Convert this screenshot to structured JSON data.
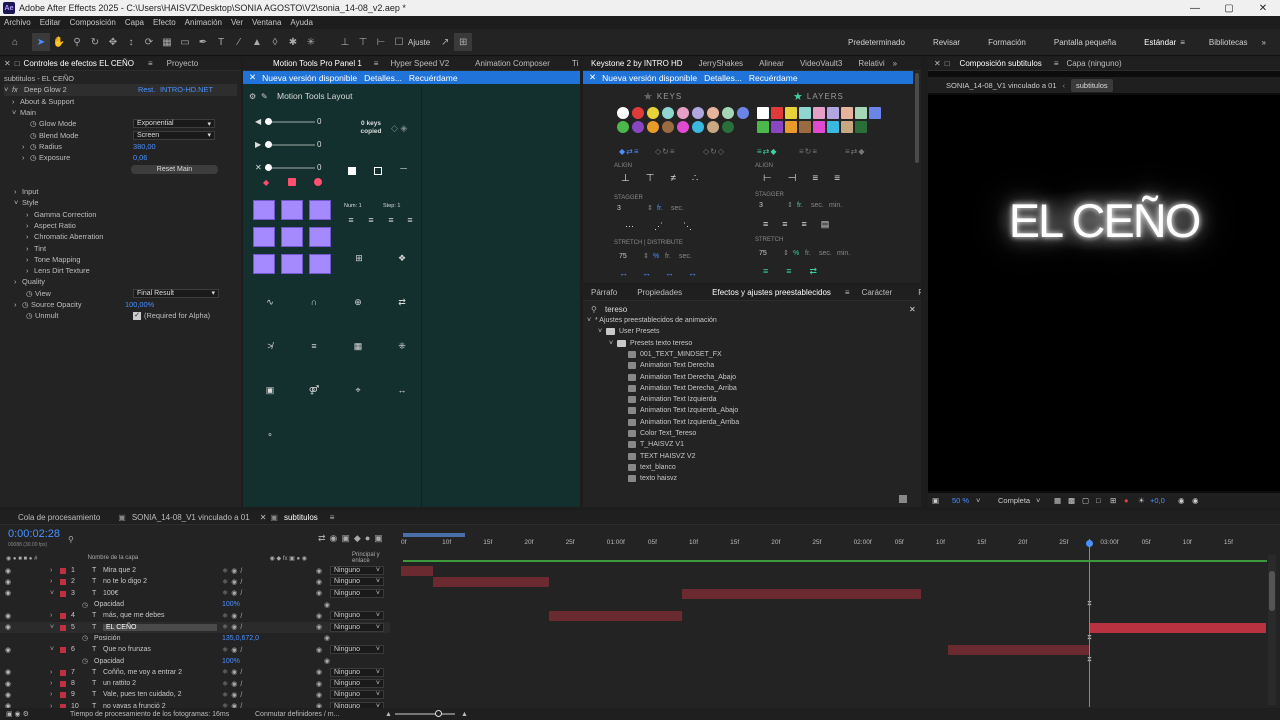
{
  "titlebar": {
    "app_title": "Adobe After Effects 2025 - C:\\Users\\HAISVZ\\Desktop\\SONIA AGOSTO\\V2\\sonia_14-08_v2.aep *",
    "logo": "Ae"
  },
  "menu": [
    "Archivo",
    "Editar",
    "Composición",
    "Capa",
    "Efecto",
    "Animación",
    "Ver",
    "Ventana",
    "Ayuda"
  ],
  "toolbar": {
    "snap_label": "Ajuste"
  },
  "workspaces": [
    "Predeterminado",
    "Revisar",
    "Formación",
    "Pantalla pequeña",
    "Estándar",
    "Bibliotecas"
  ],
  "workspace_active": "Estándar",
  "effects_panel": {
    "tabs": [
      "Controles de efectos EL CEÑO",
      "Proyecto"
    ],
    "header": "subtitulos - EL CEÑO",
    "effect_name": "Deep Glow 2",
    "reset": "Rest.",
    "license": "INTRO-HD.NET",
    "rows": [
      {
        "label": "About & Support",
        "indent": 1
      },
      {
        "label": "Main",
        "indent": 1
      },
      {
        "label": "Glow Mode",
        "indent": 3,
        "dropdown": "Exponential"
      },
      {
        "label": "Blend Mode",
        "indent": 3,
        "dropdown": "Screen"
      },
      {
        "label": "Radius",
        "indent": 2,
        "value": "380,00"
      },
      {
        "label": "Exposure",
        "indent": 2,
        "value": "0,06"
      }
    ],
    "reset_main": "Reset Main",
    "groups": [
      "Input",
      "Style",
      "Gamma Correction",
      "Aspect Ratio",
      "Chromatic Aberration",
      "Tint",
      "Tone Mapping",
      "Lens Dirt Texture",
      "Quality"
    ],
    "view_label": "View",
    "view_value": "Final Result",
    "source_opacity_label": "Source Opacity",
    "source_opacity_value": "100,00%",
    "unmult_label": "Unmult",
    "unmult_value": "(Required for Alpha)"
  },
  "motion_tools": {
    "tabs": [
      "Motion Tools Pro Panel 1",
      "Hyper Speed V2",
      "Animation Composer",
      "Ti"
    ],
    "banner": [
      "Nueva versión disponible",
      "Detalles...",
      "Recuérdame"
    ],
    "title": "Motion Tools Layout",
    "sliders": [
      "0",
      "0",
      "0"
    ],
    "keys_copied": "0 keys\ncopied",
    "num_label": "Num: 1",
    "step_label": "Step: 1"
  },
  "keystone": {
    "tabs": [
      "Keystone 2 by INTRO HD",
      "JerryShakes",
      "Alinear",
      "VideoVault3",
      "Relativi"
    ],
    "banner": [
      "Nueva versión disponible",
      "Detalles...",
      "Recuérdame"
    ],
    "keys_title": "KEYS",
    "layers_title": "LAYERS",
    "align": "ALIGN",
    "stagger": "STAGGER",
    "stretch_distribute": "STRETCH  |  DISTRIBUTE",
    "stretch": "STRETCH",
    "stagger_val": "3",
    "stretch_val": "75",
    "units": [
      "fr.",
      "sec.",
      "min."
    ],
    "percent": "%"
  },
  "presets_panel": {
    "tabs": [
      "Párrafo",
      "Propiedades",
      "Efectos y ajustes preestablecidos",
      "Carácter",
      "Rast"
    ],
    "search_value": "tereso",
    "tree": [
      {
        "label": "* Ajustes preestablecidos de animación",
        "level": 0,
        "type": "root"
      },
      {
        "label": "User Presets",
        "level": 1,
        "type": "folder"
      },
      {
        "label": "Presets texto tereso",
        "level": 2,
        "type": "folder"
      },
      {
        "label": "001_TEXT_MINDSET_FX",
        "level": 3,
        "type": "preset"
      },
      {
        "label": "Animation Text Derecha",
        "level": 3,
        "type": "preset"
      },
      {
        "label": "Animation Text Derecha_Abajo",
        "level": 3,
        "type": "preset"
      },
      {
        "label": "Animation Text Derecha_Arriba",
        "level": 3,
        "type": "preset"
      },
      {
        "label": "Animation Text Izquierda",
        "level": 3,
        "type": "preset"
      },
      {
        "label": "Animation Text Izquierda_Abajo",
        "level": 3,
        "type": "preset"
      },
      {
        "label": "Animation Text Izquierda_Arriba",
        "level": 3,
        "type": "preset"
      },
      {
        "label": "Color Text_Tereso",
        "level": 3,
        "type": "preset"
      },
      {
        "label": "T_HAISVZ V1",
        "level": 3,
        "type": "preset"
      },
      {
        "label": "TEXT HAISVZ V2",
        "level": 3,
        "type": "preset"
      },
      {
        "label": "text_blanco",
        "level": 3,
        "type": "preset"
      },
      {
        "label": "texto haisvz",
        "level": 3,
        "type": "preset"
      }
    ]
  },
  "composition": {
    "tabs": [
      "Composición subtitulos",
      "Capa (ninguno)"
    ],
    "breadcrumb": [
      "SONIA_14-08_V1 vinculado a 01",
      "subtitulos"
    ],
    "preview_text": "EL CEÑO",
    "zoom": "50 %",
    "quality": "Completa",
    "exposure": "+0,0"
  },
  "timeline": {
    "tabs": [
      "Cola de procesamiento",
      "SONIA_14-08_V1 vinculado a 01",
      "subtitulos"
    ],
    "timecode": "0:00:02:28",
    "frame_info": "00088 (30.00 fps)",
    "col_name": "Nombre de la capa",
    "col_parent": "Principal y enlace",
    "ruler": [
      "0f",
      "10f",
      "15f",
      "20f",
      "25f",
      "01:00f",
      "05f",
      "10f",
      "15f",
      "20f",
      "25f",
      "02:00f",
      "05f",
      "10f",
      "15f",
      "20f",
      "25f",
      "03:00f",
      "05f",
      "10f",
      "15f"
    ],
    "layers": [
      {
        "num": "1",
        "name": "Mira que 2",
        "parent": "Ninguno"
      },
      {
        "num": "2",
        "name": "no te lo digo 2",
        "parent": "Ninguno"
      },
      {
        "num": "3",
        "name": "100€",
        "parent": "Ninguno",
        "expanded": true
      },
      {
        "prop": "Opacidad",
        "value": "100%"
      },
      {
        "num": "4",
        "name": "más, que me debes",
        "parent": "Ninguno"
      },
      {
        "num": "5",
        "name": "EL CEÑO",
        "parent": "Ninguno",
        "selected": true,
        "expanded": true
      },
      {
        "prop": "Posición",
        "value": "135,0,672,0"
      },
      {
        "num": "6",
        "name": "Que no frunzas",
        "parent": "Ninguno",
        "expanded": true
      },
      {
        "prop": "Opacidad",
        "value": "100%"
      },
      {
        "num": "7",
        "name": "Coñño, me voy a entrar 2",
        "parent": "Ninguno"
      },
      {
        "num": "8",
        "name": "un rattito 2",
        "parent": "Ninguno"
      },
      {
        "num": "9",
        "name": "Vale, pues ten cuidado, 2",
        "parent": "Ninguno"
      },
      {
        "num": "10",
        "name": "no vayas a frunció 2",
        "parent": "Ninguno"
      }
    ],
    "status_left": "Tiempo de procesamiento de los fotogramas: 16ms",
    "status_right": "Conmutar definidores / m..."
  },
  "colors": {
    "accent": "#4a90ff",
    "banner": "#1f73d9",
    "motion_purple": "#a489ff",
    "layer_bar": "#6a2a30",
    "selected_bar": "#b8333f"
  }
}
